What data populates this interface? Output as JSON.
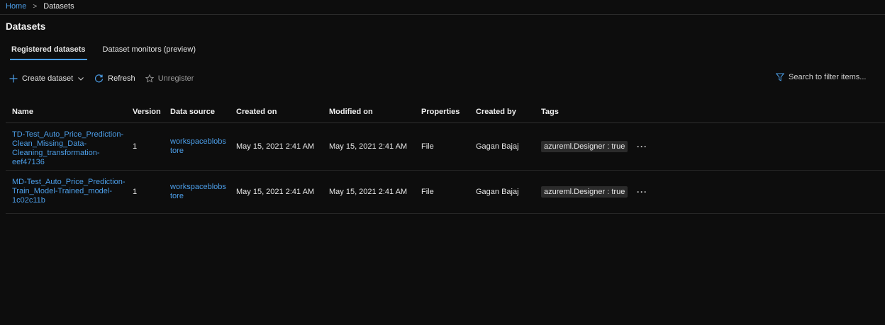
{
  "breadcrumb": {
    "home": "Home",
    "separator": ">",
    "current": "Datasets"
  },
  "page": {
    "title": "Datasets"
  },
  "tabs": [
    {
      "label": "Registered datasets"
    },
    {
      "label": "Dataset monitors (preview)"
    }
  ],
  "toolbar": {
    "create_label": "Create dataset",
    "refresh_label": "Refresh",
    "unregister_label": "Unregister",
    "search_placeholder": "Search to filter items..."
  },
  "table": {
    "columns": [
      "Name",
      "Version",
      "Data source",
      "Created on",
      "Modified on",
      "Properties",
      "Created by",
      "Tags"
    ],
    "rows": [
      {
        "name_lines": [
          "TD-Test_Auto_Price_Prediction-",
          "Clean_Missing_Data-",
          "Cleaning_transformation-",
          "eef47136"
        ],
        "version": "1",
        "source_lines": [
          "workspaceblobs",
          "tore"
        ],
        "created": "May 15, 2021 2:41 AM",
        "modified": "May 15, 2021 2:41 AM",
        "properties": "File",
        "created_by": "Gagan Bajaj",
        "tag": "azureml.Designer : true",
        "more": "···"
      },
      {
        "name_lines": [
          "MD-Test_Auto_Price_Prediction-",
          "Train_Model-Trained_model-",
          "1c02c11b"
        ],
        "version": "1",
        "source_lines": [
          "workspaceblobs",
          "tore"
        ],
        "created": "May 15, 2021 2:41 AM",
        "modified": "May 15, 2021 2:41 AM",
        "properties": "File",
        "created_by": "Gagan Bajaj",
        "tag": "azureml.Designer : true",
        "more": "···"
      }
    ]
  },
  "colors": {
    "accent": "#4c9ee8",
    "background": "#0d0d0d",
    "tag_bg": "#2b2b2b"
  }
}
